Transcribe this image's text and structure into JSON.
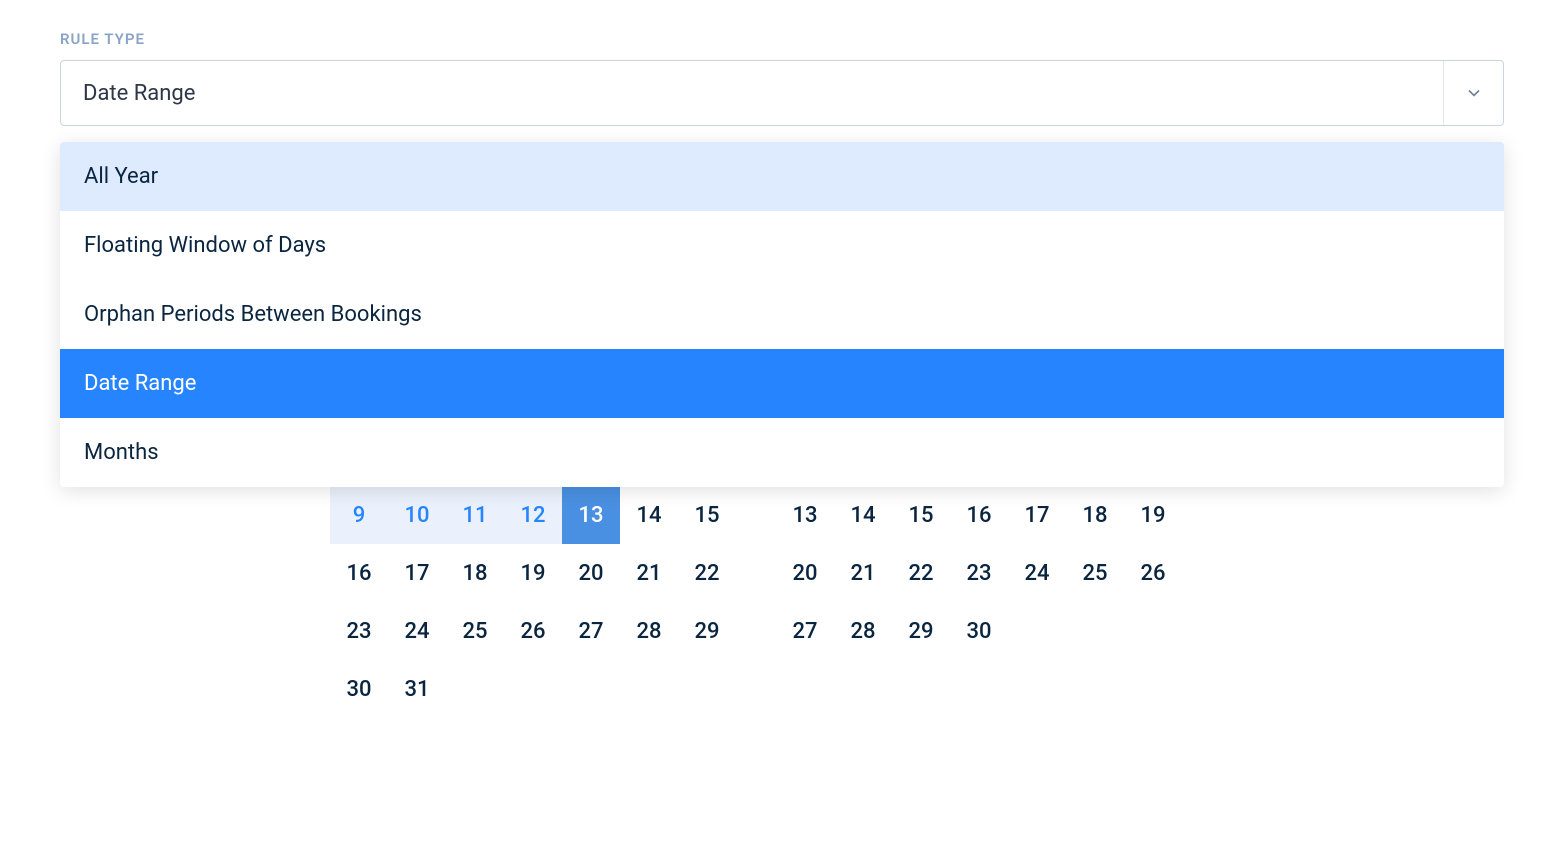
{
  "field": {
    "label": "RULE TYPE",
    "selected_value": "Date Range"
  },
  "options": [
    {
      "label": "All Year",
      "highlighted": true,
      "selected": false
    },
    {
      "label": "Floating Window of Days",
      "highlighted": false,
      "selected": false
    },
    {
      "label": "Orphan Periods Between Bookings",
      "highlighted": false,
      "selected": false
    },
    {
      "label": "Date Range",
      "highlighted": false,
      "selected": true
    },
    {
      "label": "Months",
      "highlighted": false,
      "selected": false
    }
  ],
  "calendar": {
    "left": {
      "weeks": [
        [
          {
            "d": 9,
            "in_range": true
          },
          {
            "d": 10,
            "in_range": true
          },
          {
            "d": 11,
            "in_range": true
          },
          {
            "d": 12,
            "in_range": true
          },
          {
            "d": 13,
            "range_end": true
          },
          {
            "d": 14
          },
          {
            "d": 15
          }
        ],
        [
          {
            "d": 16
          },
          {
            "d": 17
          },
          {
            "d": 18
          },
          {
            "d": 19
          },
          {
            "d": 20
          },
          {
            "d": 21
          },
          {
            "d": 22
          }
        ],
        [
          {
            "d": 23
          },
          {
            "d": 24
          },
          {
            "d": 25
          },
          {
            "d": 26
          },
          {
            "d": 27
          },
          {
            "d": 28
          },
          {
            "d": 29
          }
        ],
        [
          {
            "d": 30
          },
          {
            "d": 31
          },
          {
            "d": null
          },
          {
            "d": null
          },
          {
            "d": null
          },
          {
            "d": null
          },
          {
            "d": null
          }
        ]
      ]
    },
    "right": {
      "weeks": [
        [
          {
            "d": 13
          },
          {
            "d": 14
          },
          {
            "d": 15
          },
          {
            "d": 16
          },
          {
            "d": 17
          },
          {
            "d": 18
          },
          {
            "d": 19
          }
        ],
        [
          {
            "d": 20
          },
          {
            "d": 21
          },
          {
            "d": 22
          },
          {
            "d": 23
          },
          {
            "d": 24
          },
          {
            "d": 25
          },
          {
            "d": 26
          }
        ],
        [
          {
            "d": 27
          },
          {
            "d": 28
          },
          {
            "d": 29
          },
          {
            "d": 30
          },
          {
            "d": null
          },
          {
            "d": null
          },
          {
            "d": null
          }
        ]
      ]
    }
  }
}
